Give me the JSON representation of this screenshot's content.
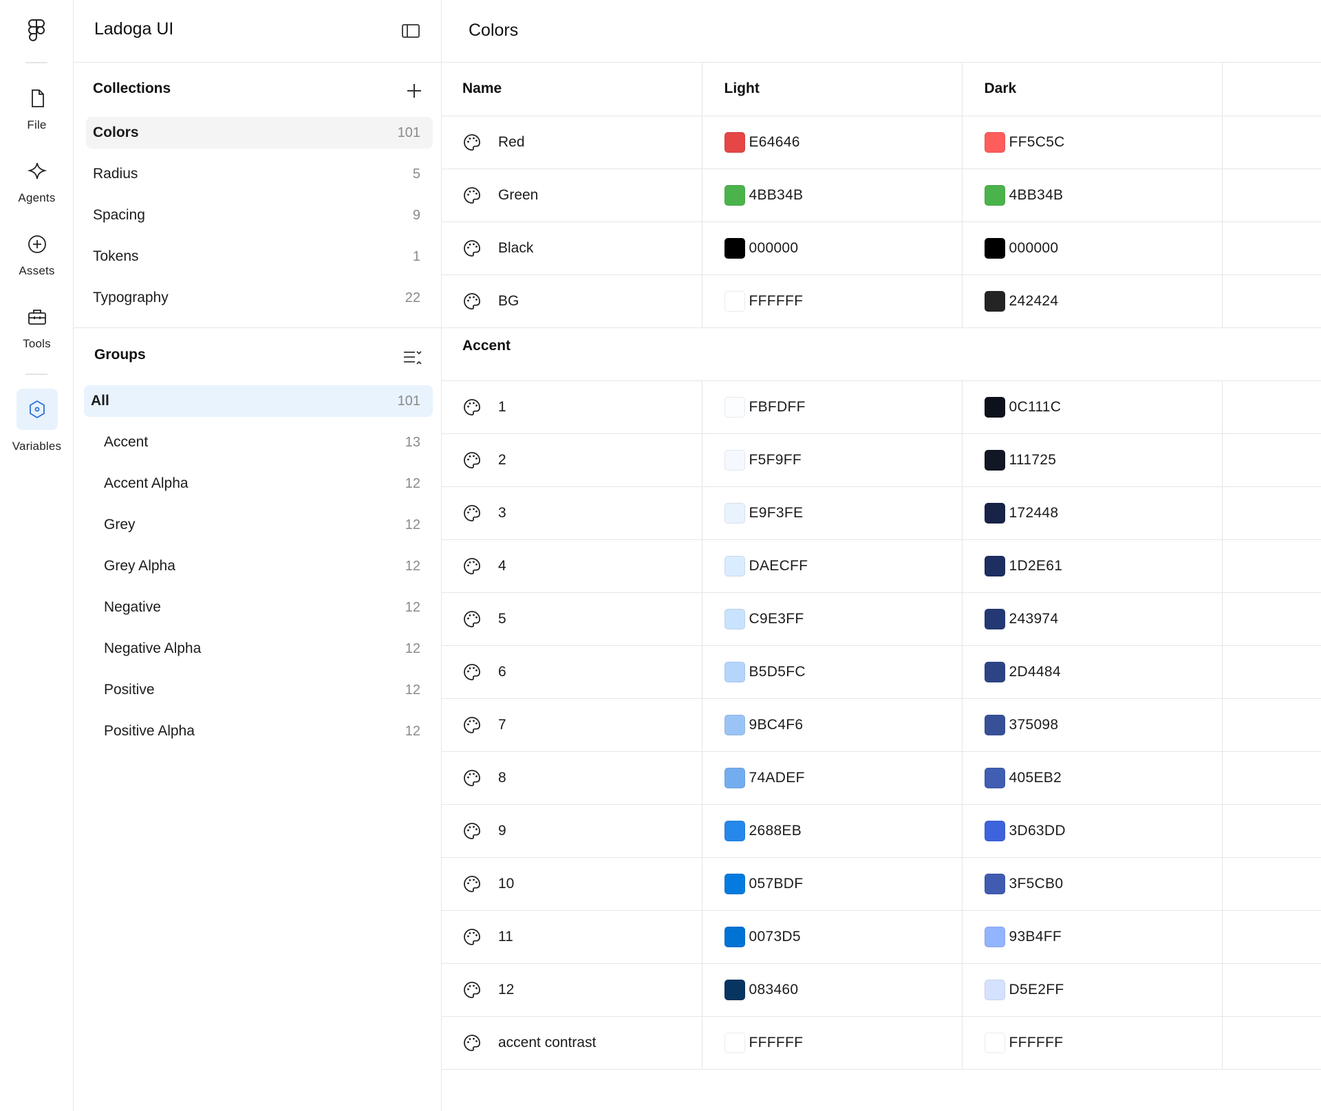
{
  "rail": {
    "items": [
      {
        "label": "File",
        "icon": "file-icon"
      },
      {
        "label": "Agents",
        "icon": "sparkle-icon"
      },
      {
        "label": "Assets",
        "icon": "plus-circle-icon"
      },
      {
        "label": "Tools",
        "icon": "toolbox-icon"
      },
      {
        "label": "Variables",
        "icon": "hexagon-icon",
        "active": true
      }
    ]
  },
  "sidebar": {
    "title": "Ladoga UI",
    "collections": {
      "title": "Collections",
      "items": [
        {
          "name": "Colors",
          "count": "101",
          "selected": true
        },
        {
          "name": "Radius",
          "count": "5"
        },
        {
          "name": "Spacing",
          "count": "9"
        },
        {
          "name": "Tokens",
          "count": "1"
        },
        {
          "name": "Typography",
          "count": "22"
        }
      ]
    },
    "groups": {
      "title": "Groups",
      "items": [
        {
          "name": "All",
          "count": "101",
          "selected": true
        },
        {
          "name": "Accent",
          "count": "13"
        },
        {
          "name": "Accent Alpha",
          "count": "12"
        },
        {
          "name": "Grey",
          "count": "12"
        },
        {
          "name": "Grey Alpha",
          "count": "12"
        },
        {
          "name": "Negative",
          "count": "12"
        },
        {
          "name": "Negative Alpha",
          "count": "12"
        },
        {
          "name": "Positive",
          "count": "12"
        },
        {
          "name": "Positive Alpha",
          "count": "12"
        }
      ]
    }
  },
  "main": {
    "title": "Colors",
    "columns": [
      "Name",
      "Light",
      "Dark"
    ],
    "base_rows": [
      {
        "name": "Red",
        "light": "E64646",
        "dark": "FF5C5C"
      },
      {
        "name": "Green",
        "light": "4BB34B",
        "dark": "4BB34B"
      },
      {
        "name": "Black",
        "light": "000000",
        "dark": "000000"
      },
      {
        "name": "BG",
        "light": "FFFFFF",
        "dark": "242424"
      }
    ],
    "group": {
      "title": "Accent",
      "rows": [
        {
          "name": "1",
          "light": "FBFDFF",
          "dark": "0C111C"
        },
        {
          "name": "2",
          "light": "F5F9FF",
          "dark": "111725"
        },
        {
          "name": "3",
          "light": "E9F3FE",
          "dark": "172448"
        },
        {
          "name": "4",
          "light": "DAECFF",
          "dark": "1D2E61"
        },
        {
          "name": "5",
          "light": "C9E3FF",
          "dark": "243974"
        },
        {
          "name": "6",
          "light": "B5D5FC",
          "dark": "2D4484"
        },
        {
          "name": "7",
          "light": "9BC4F6",
          "dark": "375098"
        },
        {
          "name": "8",
          "light": "74ADEF",
          "dark": "405EB2"
        },
        {
          "name": "9",
          "light": "2688EB",
          "dark": "3D63DD"
        },
        {
          "name": "10",
          "light": "057BDF",
          "dark": "3F5CB0"
        },
        {
          "name": "11",
          "light": "0073D5",
          "dark": "93B4FF"
        },
        {
          "name": "12",
          "light": "083460",
          "dark": "D5E2FF"
        },
        {
          "name": "accent contrast",
          "light": "FFFFFF",
          "dark": "FFFFFF"
        }
      ]
    }
  },
  "colors": {
    "accent": "#2b6fd6",
    "active_bg": "#e8f3fd",
    "selected_bg": "#f4f4f4",
    "border": "#e6e6e6"
  }
}
